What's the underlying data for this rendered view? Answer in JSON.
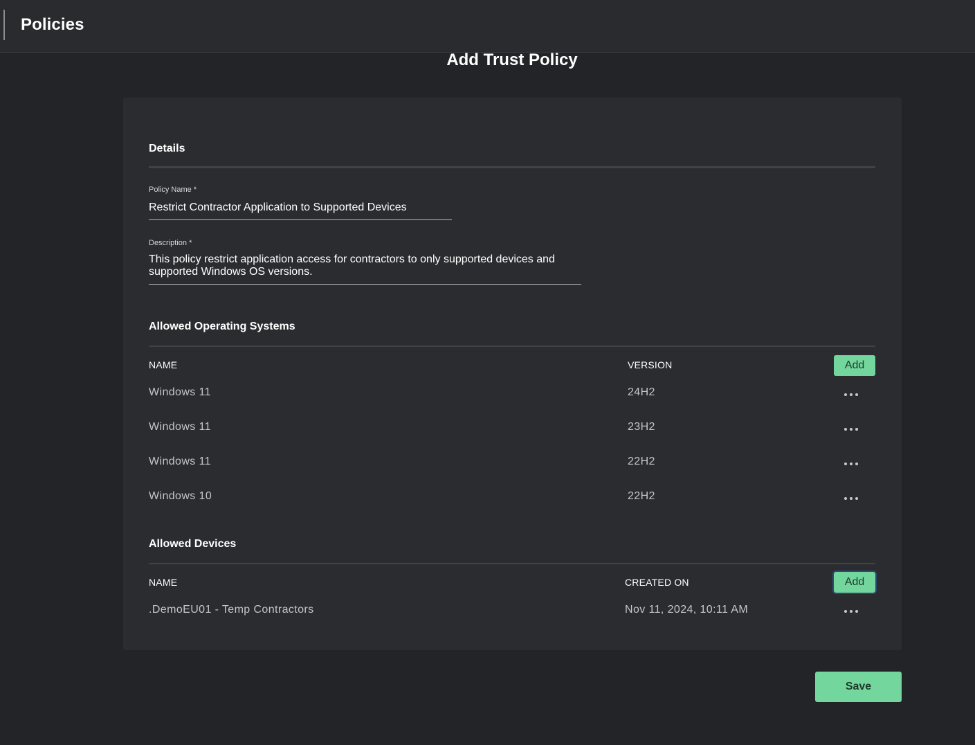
{
  "header": {
    "title": "Policies"
  },
  "page": {
    "heading": "Add Trust Policy"
  },
  "details": {
    "section_title": "Details",
    "policy_name": {
      "label": "Policy Name *",
      "value": "Restrict Contractor Application to Supported Devices"
    },
    "description": {
      "label": "Description *",
      "line1": "This policy restrict application access for contractors to only supported devices and",
      "line2": "supported Windows OS versions."
    }
  },
  "operating_systems": {
    "section_title": "Allowed Operating Systems",
    "columns": {
      "name": "NAME",
      "version": "VERSION"
    },
    "add_label": "Add",
    "rows": [
      {
        "name": "Windows 11",
        "version": "24H2"
      },
      {
        "name": "Windows 11",
        "version": "23H2"
      },
      {
        "name": "Windows 11",
        "version": "22H2"
      },
      {
        "name": "Windows 10",
        "version": "22H2"
      }
    ]
  },
  "devices": {
    "section_title": "Allowed Devices",
    "columns": {
      "name": "NAME",
      "created_on": "CREATED ON"
    },
    "add_label": "Add",
    "rows": [
      {
        "name": ".DemoEU01 - Temp Contractors",
        "created_on": "Nov 11, 2024, 10:11 AM"
      }
    ]
  },
  "footer": {
    "save_label": "Save"
  },
  "colors": {
    "accent": "#73d69c",
    "background": "#232427",
    "card": "#2b2c30"
  },
  "icons": {
    "row_menu": "more-horizontal-icon"
  }
}
